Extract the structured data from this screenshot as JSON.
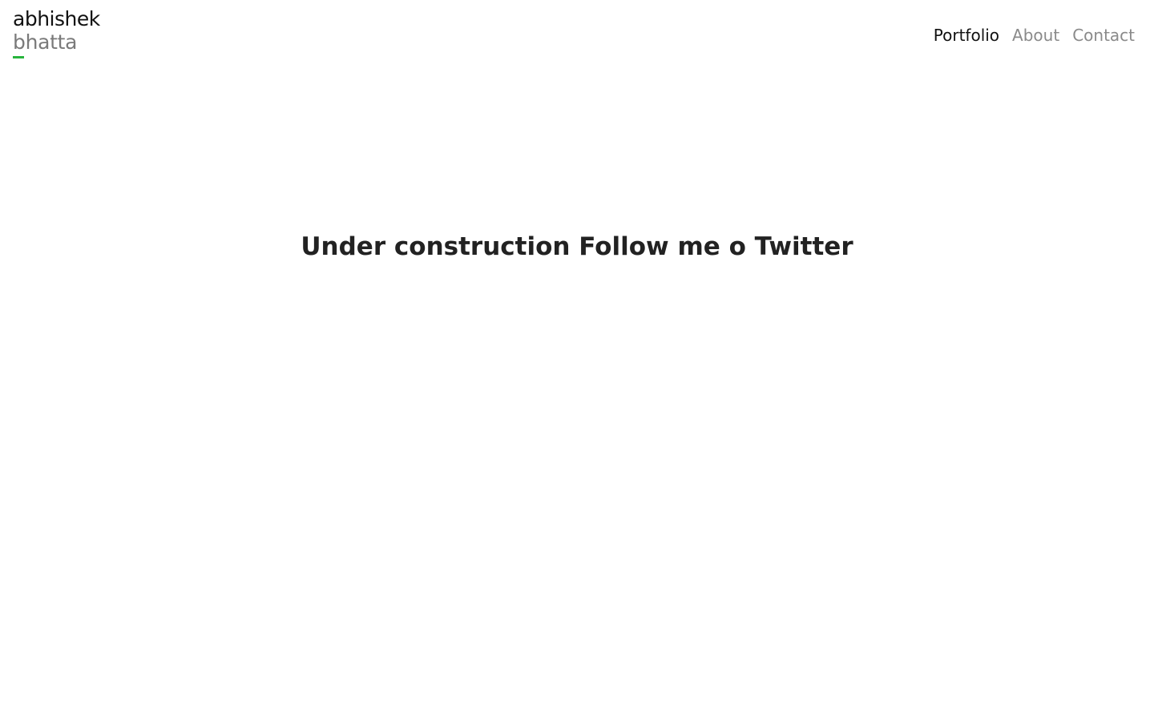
{
  "logo": {
    "line1": "abhishek",
    "line2": "bhatta",
    "accent_color": "#28b43c"
  },
  "nav": {
    "items": [
      {
        "label": "Portfolio",
        "active": true
      },
      {
        "label": "About",
        "active": false
      },
      {
        "label": "Contact",
        "active": false
      }
    ]
  },
  "main": {
    "message": "Under construction Follow me o Twitter"
  }
}
